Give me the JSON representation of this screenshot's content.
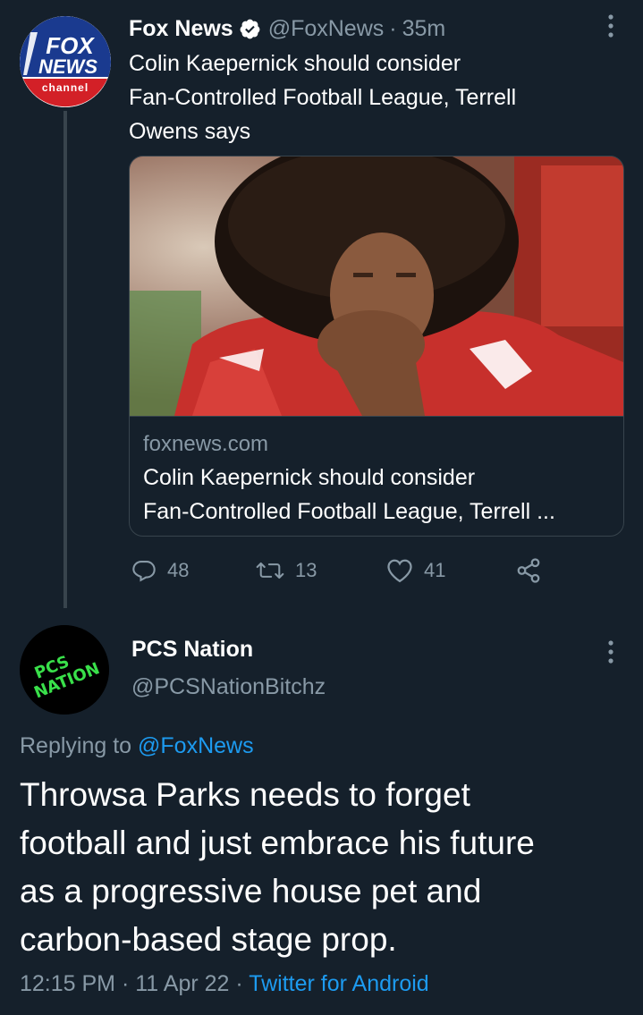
{
  "parent_tweet": {
    "display_name": "Fox News",
    "handle": "@FoxNews",
    "separator": "·",
    "time": "35m",
    "avatar": {
      "logo_text_top": "FOX",
      "logo_text_mid": "NEWS",
      "logo_text_bottom": "channel"
    },
    "text_lines": [
      "Colin Kaepernick should consider",
      "Fan-Controlled Football League, Terrell",
      "Owens says"
    ],
    "card": {
      "domain": "foxnews.com",
      "title_lines": [
        "Colin Kaepernick should consider",
        "Fan-Controlled Football League, Terrell ..."
      ],
      "image_icon": "player-photo"
    },
    "actions": {
      "replies": "48",
      "retweets": "13",
      "likes": "41"
    }
  },
  "reply_tweet": {
    "display_name": "PCS Nation",
    "handle": "@PCSNationBitchz",
    "avatar": {
      "logo_line1": "PCS",
      "logo_line2": "NATION"
    },
    "replying_to_prefix": "Replying to",
    "replying_to_mention": "@FoxNews",
    "text_lines": [
      "Throwsa Parks needs to forget",
      "football and just embrace his future",
      "as a progressive house pet and",
      "carbon-based stage prop."
    ],
    "time": "12:15 PM",
    "date": "11 Apr 22",
    "separator": "·",
    "source": "Twitter for Android"
  },
  "colors": {
    "background": "#15202b",
    "secondary_text": "#8899a6",
    "link": "#1d9bf0",
    "border": "#38444d",
    "verified_badge": "#ffffff"
  }
}
